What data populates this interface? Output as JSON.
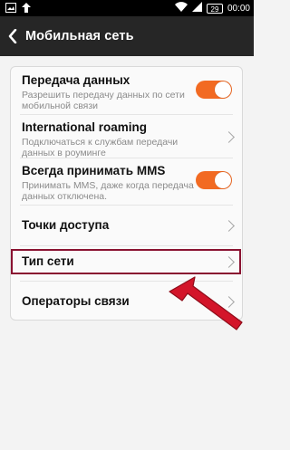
{
  "status_bar": {
    "time": "00:00",
    "battery": "29",
    "icons": [
      "image-icon",
      "upload-icon",
      "wifi-icon",
      "signal-icon",
      "battery-icon"
    ]
  },
  "app_bar": {
    "title": "Мобильная сеть",
    "back_icon": "back-chevron-icon"
  },
  "settings": {
    "items": [
      {
        "title": "Передача данных",
        "subtitle": "Разрешить передачу данных по сети мобильной связи",
        "control": "toggle",
        "on": true
      },
      {
        "title": "International roaming",
        "subtitle": "Подключаться к службам передачи данных в роуминге",
        "control": "chevron"
      },
      {
        "title": "Всегда принимать MMS",
        "subtitle": "Принимать MMS, даже когда передача данных отключена.",
        "control": "toggle",
        "on": true
      },
      {
        "title": "Точки доступа",
        "subtitle": "",
        "control": "chevron"
      },
      {
        "title": "Тип сети",
        "subtitle": "",
        "control": "chevron"
      },
      {
        "title": "Операторы связи",
        "subtitle": "",
        "control": "chevron"
      }
    ]
  },
  "annotation": {
    "highlight_color": "#8a1231",
    "arrow_color": "#d3152a"
  },
  "colors": {
    "toggle_on": "#f26a22",
    "app_bar": "#262626",
    "background": "#f3f3f3"
  }
}
